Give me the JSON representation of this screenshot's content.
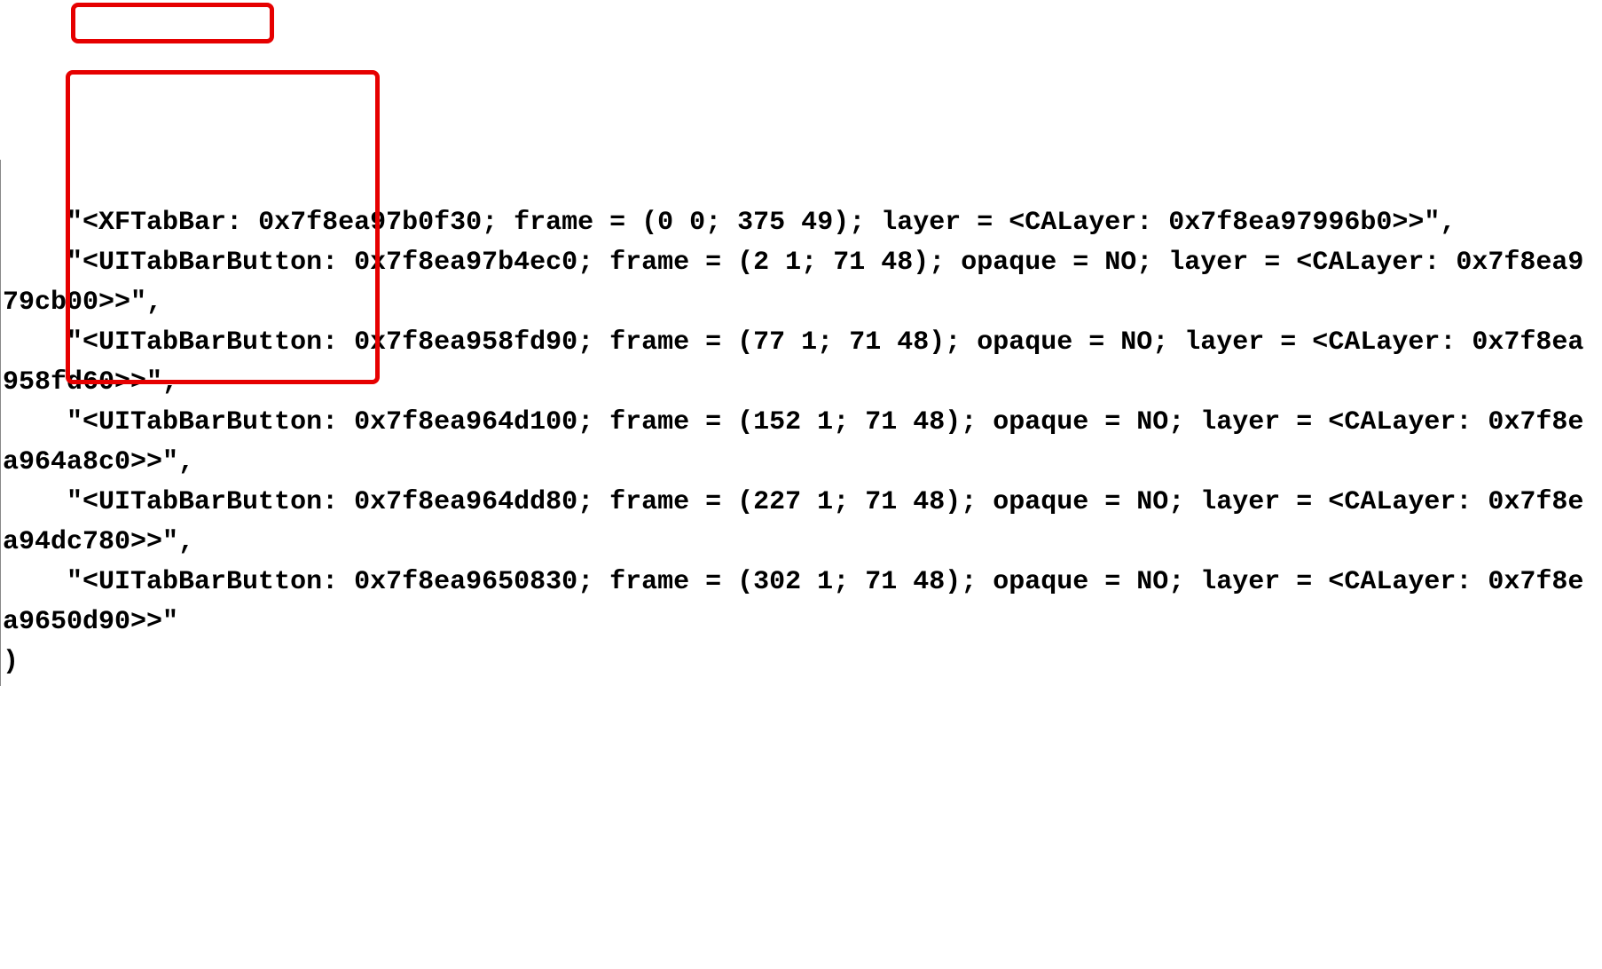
{
  "output": {
    "tabbar": {
      "class": "XFTabBar",
      "address": "0x7f8ea97b0f30",
      "frame": "(0 0; 375 49)",
      "layer_class": "CALayer",
      "layer_address": "0x7f8ea97996b0"
    },
    "buttons": [
      {
        "class": "UITabBarButton",
        "address": "0x7f8ea97b4ec0",
        "frame": "(2 1; 71 48)",
        "opaque": "NO",
        "layer_class": "CALayer",
        "layer_address": "0x7f8ea979cb00"
      },
      {
        "class": "UITabBarButton",
        "address": "0x7f8ea958fd90",
        "frame": "(77 1; 71 48)",
        "opaque": "NO",
        "layer_class": "CALayer",
        "layer_address": "0x7f8ea958fd60"
      },
      {
        "class": "UITabBarButton",
        "address": "0x7f8ea964d100",
        "frame": "(152 1; 71 48)",
        "opaque": "NO",
        "layer_class": "CALayer",
        "layer_address": "0x7f8ea964a8c0"
      },
      {
        "class": "UITabBarButton",
        "address": "0x7f8ea964dd80",
        "frame": "(227 1; 71 48)",
        "opaque": "NO",
        "layer_class": "CALayer",
        "layer_address": "0x7f8ea94dc780"
      },
      {
        "class": "UITabBarButton",
        "address": "0x7f8ea9650830",
        "frame": "(302 1; 71 48)",
        "opaque": "NO",
        "layer_class": "CALayer",
        "layer_address": "0x7f8ea9650d90"
      }
    ],
    "closing_paren": ")"
  }
}
